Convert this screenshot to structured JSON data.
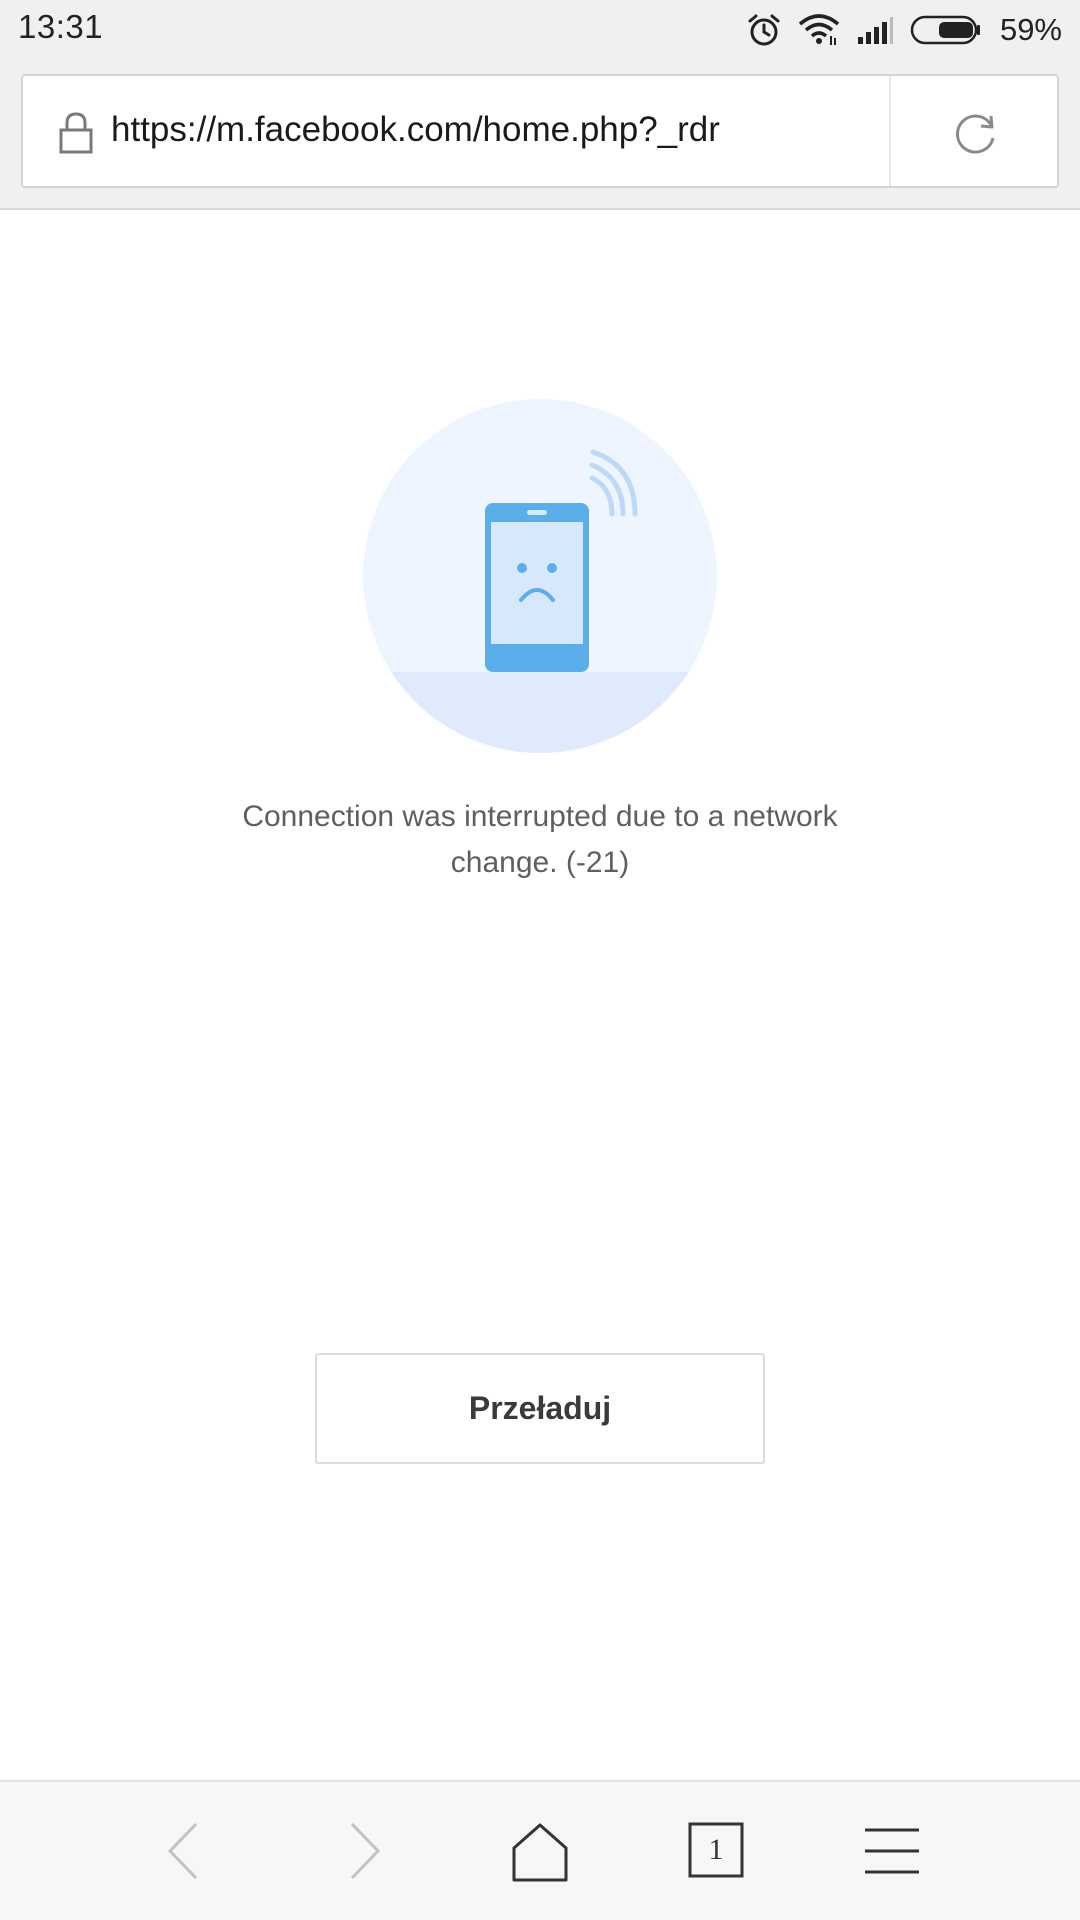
{
  "status_bar": {
    "time": "13:31",
    "battery_percent": "59%",
    "battery_level": 0.59,
    "icons": [
      "alarm-icon",
      "wifi-icon",
      "signal-icon",
      "battery-icon"
    ]
  },
  "address_bar": {
    "url": "https://m.facebook.com/home.php?_rdr",
    "secure": true
  },
  "error": {
    "message": "Connection was interrupted due to a network change. (-21)",
    "illustration": "sad-phone-no-connection"
  },
  "actions": {
    "reload_label": "Przeładuj"
  },
  "bottom_nav": {
    "tabs_count": "1",
    "items": [
      "back-icon",
      "forward-icon",
      "home-icon",
      "tabs-icon",
      "menu-icon"
    ]
  },
  "colors": {
    "accent_blue": "#5aaeea",
    "illustration_bg": "#eef5fe",
    "chrome_bg": "#eff0f2"
  }
}
